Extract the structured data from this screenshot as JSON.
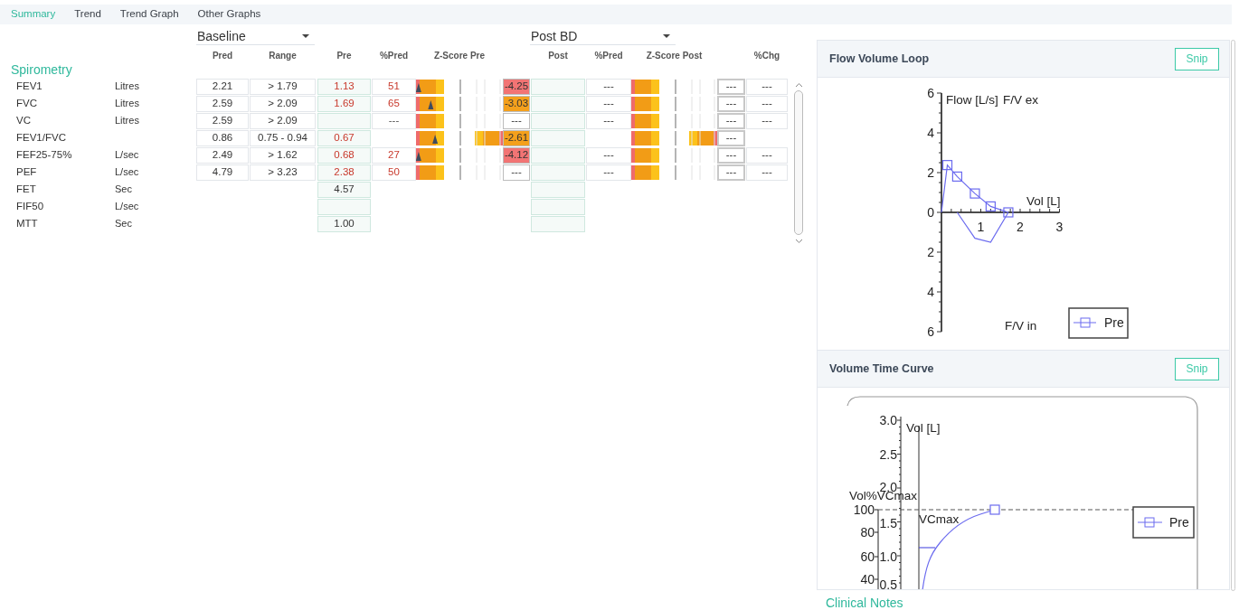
{
  "tabs": [
    {
      "label": "Summary",
      "selected": true
    },
    {
      "label": "Trend",
      "selected": false
    },
    {
      "label": "Trend Graph",
      "selected": false
    },
    {
      "label": "Other Graphs",
      "selected": false
    }
  ],
  "baseline_dropdown": {
    "value": "Baseline"
  },
  "post_dropdown": {
    "value": "Post BD"
  },
  "columns": [
    "Pred",
    "Range",
    "Pre",
    "%Pred",
    "Z-Score Pre",
    "Post",
    "%Pred",
    "Z-Score Post",
    "%Chg"
  ],
  "section_title": "Spirometry",
  "rows": [
    {
      "name": "FEV1",
      "unit": "Litres",
      "pred": "2.21",
      "range": "> 1.79",
      "pre": "1.13",
      "pre_abnormal": true,
      "pre_pct": "51",
      "z_pre_bar": {
        "two_sided": false,
        "level": 0.03
      },
      "z_pre": {
        "value": "-4.25",
        "color": "#f27474"
      },
      "post_pct": "---",
      "z_post_bar": {
        "two_sided": false
      },
      "column_12": "---",
      "chg": "---"
    },
    {
      "name": "FVC",
      "unit": "Litres",
      "pred": "2.59",
      "range": "> 2.09",
      "pre": "1.69",
      "pre_abnormal": true,
      "pre_pct": "65",
      "z_pre_bar": {
        "two_sided": false,
        "level": 0.17
      },
      "z_pre": {
        "value": "-3.03",
        "color": "#f4a01c"
      },
      "post_pct": "---",
      "z_post_bar": {
        "two_sided": false
      },
      "column_12": "---",
      "chg": "---"
    },
    {
      "name": "VC",
      "unit": "Litres",
      "pred": "2.59",
      "range": "> 2.09",
      "pre_pct": "---",
      "z_pre_bar": {
        "two_sided": false
      },
      "z_pre": {
        "value": "---"
      },
      "post_pct": "---",
      "z_post_bar": {
        "two_sided": false
      },
      "column_12": "---",
      "chg": "---"
    },
    {
      "name": "FEV1/FVC",
      "pred": "0.86",
      "range": "0.75 - 0.94",
      "pre": "0.67",
      "pre_abnormal": true,
      "z_pre_bar": {
        "two_sided": true,
        "level": 0.22
      },
      "z_pre": {
        "value": "-2.61",
        "color": "#f4a01c"
      },
      "z_post_bar": {
        "two_sided": true
      },
      "column_12": "---"
    },
    {
      "name": "FEF25-75%",
      "unit": "L/sec",
      "pred": "2.49",
      "range": "> 1.62",
      "pre": "0.68",
      "pre_abnormal": true,
      "pre_pct": "27",
      "z_pre_bar": {
        "two_sided": false,
        "level": 0.03
      },
      "z_pre": {
        "value": "-4.12",
        "color": "#f27474"
      },
      "post_pct": "---",
      "z_post_bar": {
        "two_sided": false
      },
      "column_12": "---",
      "chg": "---"
    },
    {
      "name": "PEF",
      "unit": "L/sec",
      "pred": "4.79",
      "range": "> 3.23",
      "pre": "2.38",
      "pre_abnormal": true,
      "pre_pct": "50",
      "z_pre_bar": {
        "two_sided": false
      },
      "z_pre": {
        "value": "---"
      },
      "post_pct": "---",
      "z_post_bar": {
        "two_sided": false
      },
      "column_12": "---",
      "chg": "---"
    },
    {
      "name": "FET",
      "unit": "Sec",
      "pre": "4.57",
      "pre_abnormal": false
    },
    {
      "name": "FIF50",
      "unit": "L/sec"
    },
    {
      "name": "MTT",
      "unit": "Sec",
      "pre": "1.00",
      "pre_abnormal": false
    }
  ],
  "flow_volume_loop": {
    "title": "Flow Volume Loop",
    "snip": "Snip",
    "chart_data": {
      "type": "line",
      "xlabel": "Vol [L]",
      "ylabel": "Flow [L/s]",
      "x": [
        0,
        0.15,
        0.4,
        0.85,
        1.25,
        1.7
      ],
      "series": [
        {
          "name": "Pre",
          "color": "#6b6bef",
          "marker": "square",
          "values": [
            0,
            2.38,
            1.8,
            0.95,
            0.3,
            0
          ]
        },
        {
          "color": "#6b6bef",
          "values": [
            null,
            null,
            0,
            -1.3,
            -1.5,
            0
          ]
        }
      ],
      "xlim": [
        0,
        3
      ],
      "ylim": [
        -6,
        6
      ],
      "xticks": [
        1,
        2,
        3
      ],
      "yticks": [
        {
          "value": 6,
          "label": "6"
        },
        {
          "value": 4,
          "label": "4"
        },
        {
          "value": 2,
          "label": "2"
        },
        {
          "value": 0,
          "label": "0"
        },
        {
          "value": -2,
          "label": "2"
        },
        {
          "value": -4,
          "label": "4"
        },
        {
          "value": -6,
          "label": "6"
        }
      ],
      "annotations": [
        "F/V ex",
        "F/V in"
      ]
    }
  },
  "volume_time_curve": {
    "title": "Volume Time Curve",
    "snip": "Snip",
    "volume_label": "Vol [L]",
    "percent_label": "Vol%VCmax",
    "marker_label": "VCmax",
    "legend": "Pre",
    "volume_ticks": [
      "3.0",
      "2.5",
      "2.0",
      "1.5",
      "1.0",
      "0.5"
    ],
    "percent_ticks": [
      "100",
      "80",
      "60",
      "40"
    ]
  },
  "clinical_notes_label": "Clinical Notes"
}
